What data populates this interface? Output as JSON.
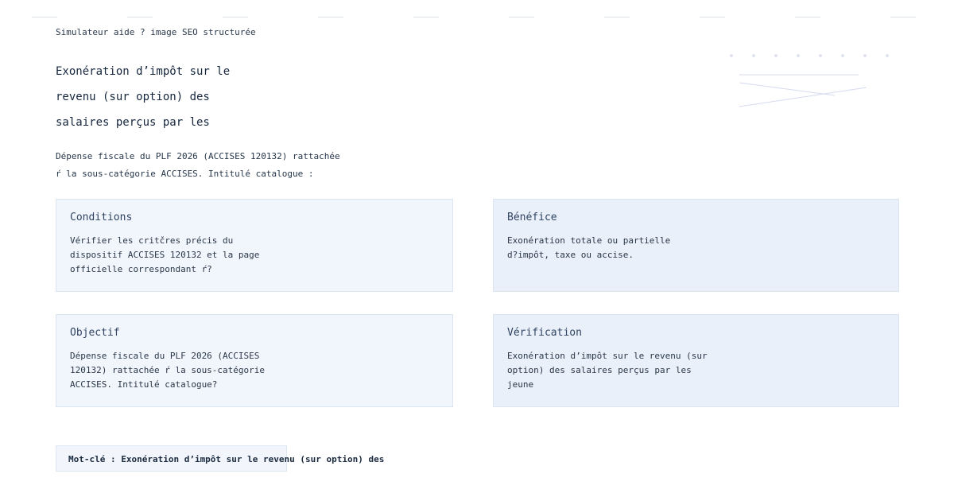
{
  "header": {
    "kicker": "Simulateur aide ? image SEO structurée",
    "title_lines": [
      "Exonération d’impôt sur le",
      "revenu (sur option) des",
      "salaires perçus par les"
    ],
    "intro_lines": [
      "Dépense fiscale du PLF 2026 (ACCISES 120132) rattachée",
      "ŕ la sous-catégorie ACCISES. Intitulé catalogue :"
    ]
  },
  "cards": [
    {
      "title": "Conditions",
      "lines": [
        "Vérifier les critčres précis du",
        "dispositif ACCISES 120132 et la page",
        "officielle correspondant ŕ?"
      ]
    },
    {
      "title": "Bénéfice",
      "lines": [
        "Exonération totale ou partielle",
        "d?impôt, taxe ou accise."
      ]
    },
    {
      "title": "Objectif",
      "lines": [
        "Dépense fiscale du PLF 2026 (ACCISES",
        "120132) rattachée ŕ la sous-catégorie",
        "ACCISES. Intitulé catalogue?"
      ]
    },
    {
      "title": "Vérification",
      "lines": [
        "Exonération d’impôt sur le revenu (sur",
        "option) des salaires perçus par les",
        "jeune"
      ]
    }
  ],
  "keyword": "Mot-clé : Exonération d’impôt sur le revenu (sur option) des",
  "colors": {
    "card_light": "#f1f6fd",
    "card_mid": "#e9f0fa",
    "text": "#1e2f45",
    "accent_lines": "#c8cde8"
  }
}
